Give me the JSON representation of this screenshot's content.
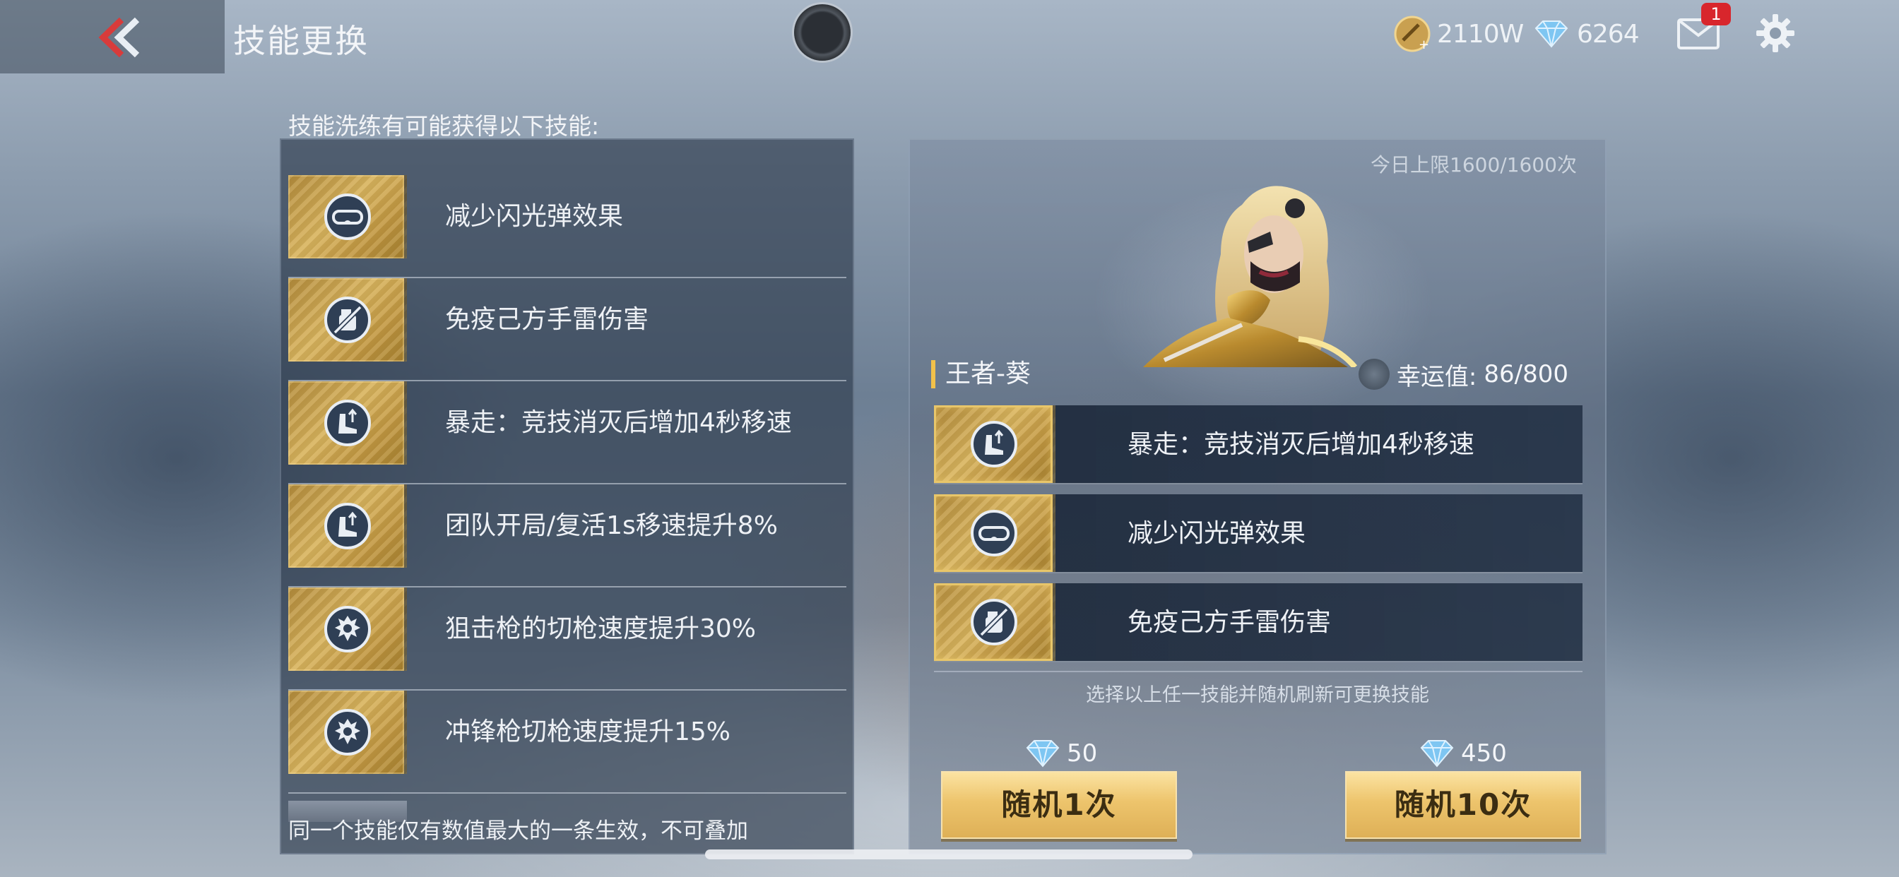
{
  "header": {
    "title": "技能更换",
    "coins": "2110W",
    "gems": "6264",
    "mail_badge": "1"
  },
  "left": {
    "caption": "技能洗练有可能获得以下技能:",
    "skills": [
      {
        "label": "减少闪光弹效果",
        "icon": "goggles-icon"
      },
      {
        "label": "免疫己方手雷伤害",
        "icon": "grenade-immune-icon"
      },
      {
        "label": "暴走：竞技消灭后增加4秒移速",
        "icon": "speed-boot-icon"
      },
      {
        "label": "团队开局/复活1s移速提升8%",
        "icon": "speed-boot-icon"
      },
      {
        "label": "狙击枪的切枪速度提升30%",
        "icon": "dragon-emblem-icon"
      },
      {
        "label": "冲锋枪切枪速度提升15%",
        "icon": "dragon-emblem-icon"
      }
    ],
    "footnote": "同一个技能仅有数值最大的一条生效，不可叠加"
  },
  "right": {
    "daily_limit": "今日上限1600/1600次",
    "character_name": "王者-葵",
    "luck_label": "幸运值:",
    "luck_value": "86/800",
    "owned_skills": [
      {
        "label": "暴走：竞技消灭后增加4秒移速",
        "icon": "speed-boot-icon"
      },
      {
        "label": "减少闪光弹效果",
        "icon": "goggles-icon"
      },
      {
        "label": "免疫己方手雷伤害",
        "icon": "grenade-immune-icon"
      }
    ],
    "hint": "选择以上任一技能并随机刷新可更换技能",
    "random_once": {
      "cost": "50",
      "label": "随机1次"
    },
    "random_ten": {
      "cost": "450",
      "label": "随机10次"
    }
  },
  "colors": {
    "gold": "#d9b45d",
    "accent_bar": "#f2c14a",
    "badge": "#d8262c"
  }
}
